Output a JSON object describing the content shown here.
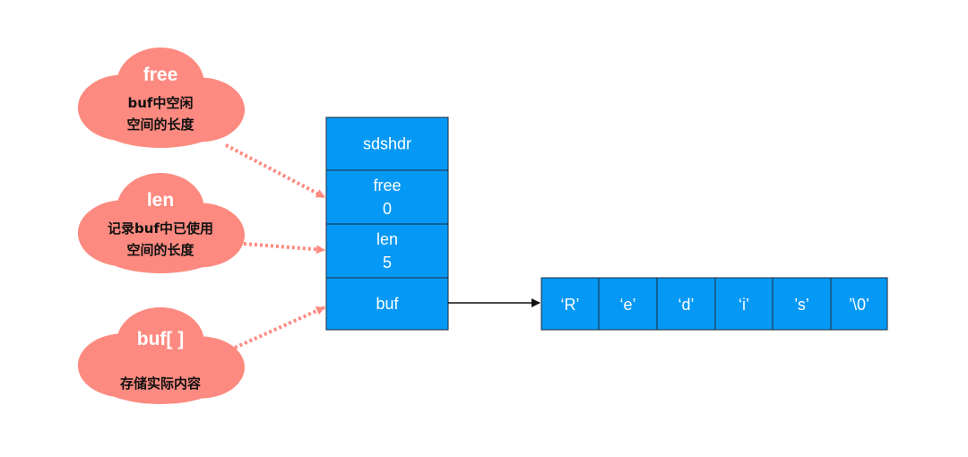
{
  "colors": {
    "cloud": "#fd8a80",
    "box": "#0598f5",
    "box_border": "#1f2a3a",
    "dotted_arrow": "#fd8a80",
    "pointer_arrow": "#111111"
  },
  "clouds": [
    {
      "title": "free",
      "lines": [
        "buf中空闲",
        "空间的长度"
      ],
      "target": "free"
    },
    {
      "title": "len",
      "lines": [
        "记录buf中已使用",
        "空间的长度"
      ],
      "target": "len"
    },
    {
      "title": "buf[ ]",
      "lines": [
        "存储实际内容"
      ],
      "target": "buf"
    }
  ],
  "sdshdr": {
    "fields": [
      {
        "key": "sdshdr",
        "lines": [
          "sdshdr"
        ]
      },
      {
        "key": "free",
        "lines": [
          "free",
          "0"
        ]
      },
      {
        "key": "len",
        "lines": [
          "len",
          "5"
        ]
      },
      {
        "key": "buf",
        "lines": [
          "buf"
        ]
      }
    ]
  },
  "buffer": {
    "cells": [
      "‘R’",
      "‘e’",
      "‘d’",
      "‘i’",
      "’s’",
      "’\\0’"
    ]
  }
}
